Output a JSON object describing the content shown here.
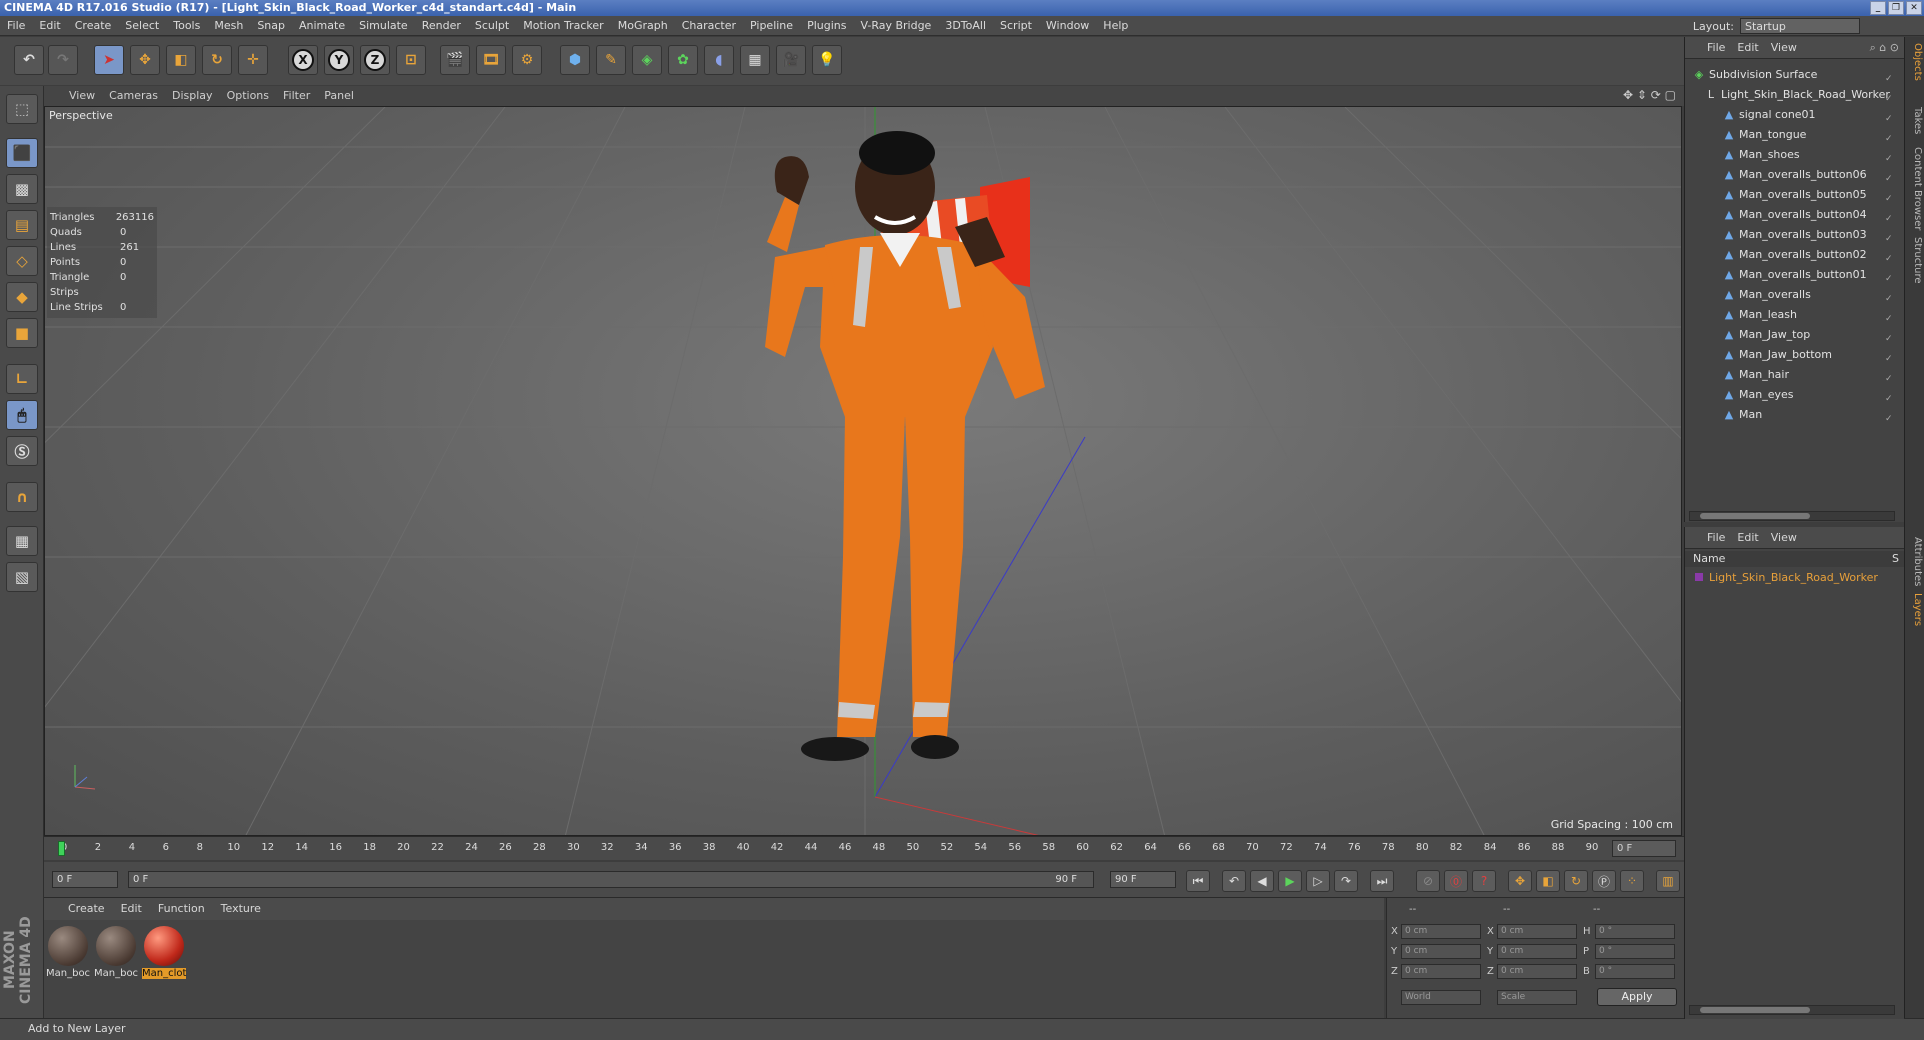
{
  "window": {
    "title": "CINEMA 4D R17.016 Studio (R17) - [Light_Skin_Black_Road_Worker_c4d_standart.c4d] - Main"
  },
  "menu": [
    "File",
    "Edit",
    "Create",
    "Select",
    "Tools",
    "Mesh",
    "Snap",
    "Animate",
    "Simulate",
    "Render",
    "Sculpt",
    "Motion Tracker",
    "MoGraph",
    "Character",
    "Pipeline",
    "Plugins",
    "V-Ray Bridge",
    "3DToAll",
    "Script",
    "Window",
    "Help"
  ],
  "layout": {
    "label": "Layout:",
    "value": "Startup"
  },
  "toolbar": {
    "x": "X",
    "y": "Y",
    "z": "Z"
  },
  "viewport": {
    "menu": [
      "View",
      "Cameras",
      "Display",
      "Options",
      "Filter",
      "Panel"
    ],
    "label": "Perspective",
    "stats": [
      {
        "k": "Triangles",
        "v": "263116"
      },
      {
        "k": "Quads",
        "v": "0"
      },
      {
        "k": "Lines",
        "v": "261"
      },
      {
        "k": "Points",
        "v": "0"
      },
      {
        "k": "Triangle Strips",
        "v": "0"
      },
      {
        "k": "Line Strips",
        "v": "0"
      }
    ],
    "grid_spacing": "Grid Spacing : 100 cm"
  },
  "timeline": {
    "ticks": [
      "0",
      "2",
      "4",
      "6",
      "8",
      "10",
      "12",
      "14",
      "16",
      "18",
      "20",
      "22",
      "24",
      "26",
      "28",
      "30",
      "32",
      "34",
      "36",
      "38",
      "40",
      "42",
      "44",
      "46",
      "48",
      "50",
      "52",
      "54",
      "56",
      "58",
      "60",
      "62",
      "64",
      "66",
      "68",
      "70",
      "72",
      "74",
      "76",
      "78",
      "80",
      "82",
      "84",
      "86",
      "88",
      "90"
    ],
    "current": "0 F"
  },
  "transport": {
    "start": "0 F",
    "range_start": "0 F",
    "range_end": "90 F",
    "end": "90 F"
  },
  "materials": {
    "menu": [
      "Create",
      "Edit",
      "Function",
      "Texture"
    ],
    "items": [
      "Man_boc",
      "Man_boc",
      "Man_clot"
    ]
  },
  "coords": {
    "header": [
      "--",
      "--",
      "--"
    ],
    "rows": [
      {
        "a": "X",
        "av": "0 cm",
        "b": "X",
        "bv": "0 cm",
        "c": "H",
        "cv": "0 °"
      },
      {
        "a": "Y",
        "av": "0 cm",
        "b": "Y",
        "bv": "0 cm",
        "c": "P",
        "cv": "0 °"
      },
      {
        "a": "Z",
        "av": "0 cm",
        "b": "Z",
        "bv": "0 cm",
        "c": "B",
        "cv": "0 °"
      }
    ],
    "world": "World",
    "scale": "Scale",
    "apply": "Apply"
  },
  "status": "Add to New Layer",
  "brand": "MAXON CINEMA 4D",
  "objects": {
    "menu": [
      "File",
      "Edit",
      "View"
    ],
    "items": [
      "Subdivision Surface",
      "Light_Skin_Black_Road_Worker",
      "signal cone01",
      "Man_tongue",
      "Man_shoes",
      "Man_overalls_button06",
      "Man_overalls_button05",
      "Man_overalls_button04",
      "Man_overalls_button03",
      "Man_overalls_button02",
      "Man_overalls_button01",
      "Man_overalls",
      "Man_leash",
      "Man_Jaw_top",
      "Man_Jaw_bottom",
      "Man_hair",
      "Man_eyes",
      "Man"
    ]
  },
  "layers": {
    "menu": [
      "File",
      "Edit",
      "View"
    ],
    "name_header": "Name",
    "s_header": "S",
    "row": "Light_Skin_Black_Road_Worker"
  },
  "side_tabs": [
    "Objects",
    "Takes",
    "Content Browser",
    "Structure",
    "Attributes",
    "Layers"
  ]
}
